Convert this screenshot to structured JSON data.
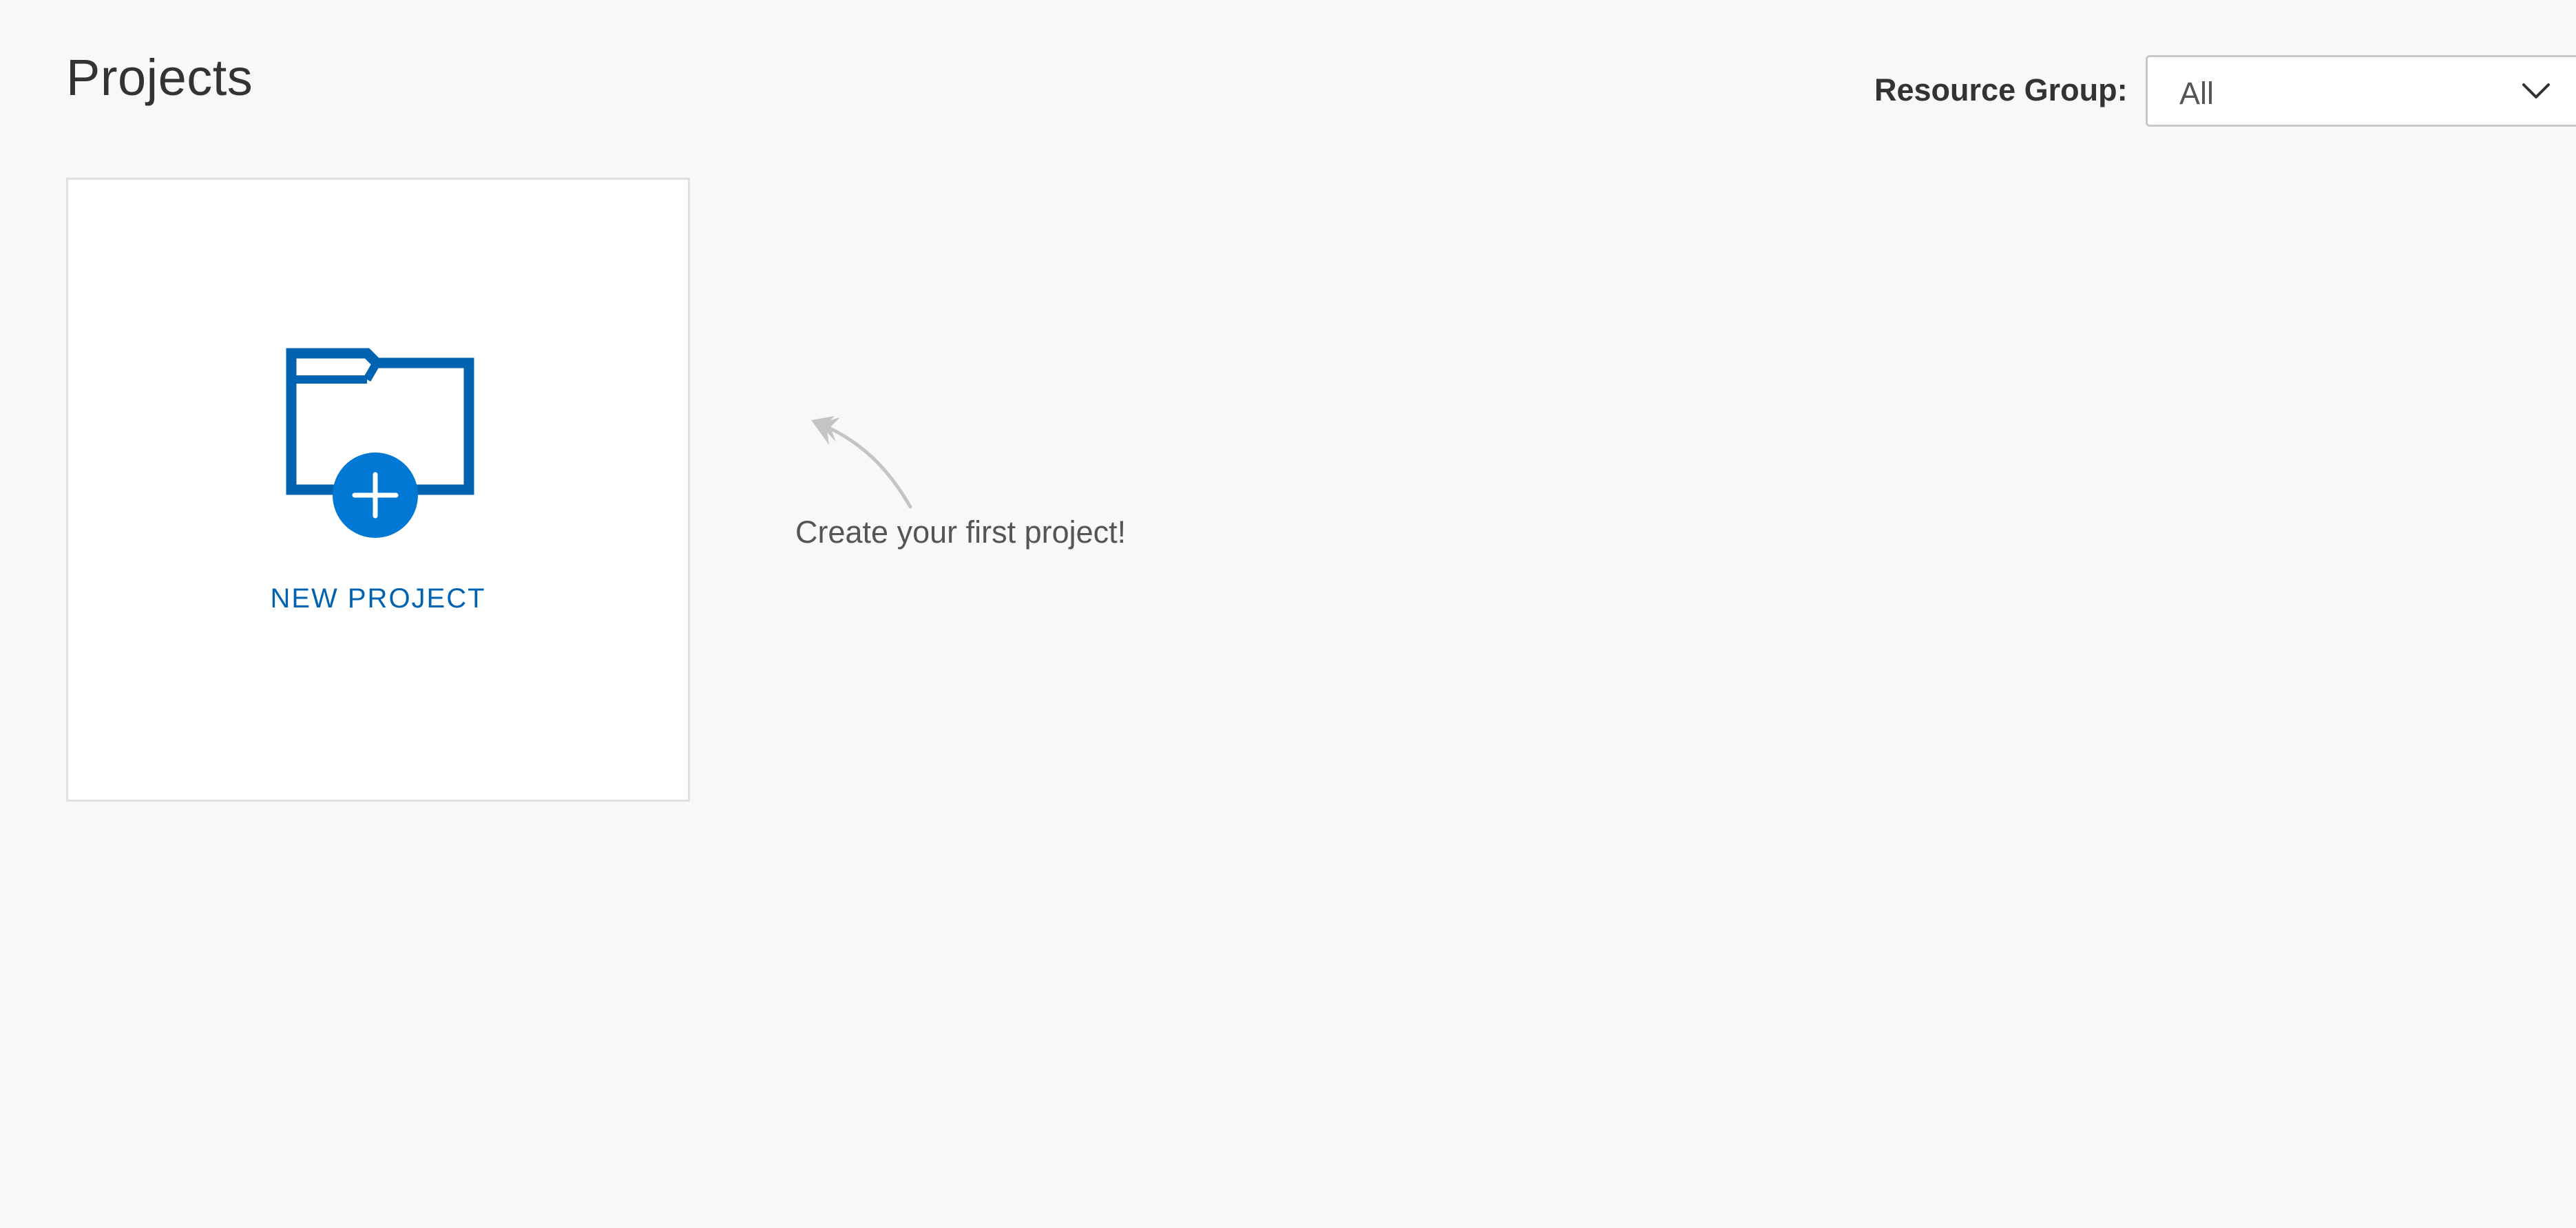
{
  "header": {
    "title": "Projects"
  },
  "filter": {
    "label": "Resource Group:",
    "selected": "All",
    "icon": "chevron-down-icon"
  },
  "new_project_card": {
    "label": "NEW PROJECT",
    "icon": "folder-add-icon",
    "accent_color": "#0063b1",
    "plus_color": "#0078d4"
  },
  "hint": {
    "text": "Create your first project!",
    "icon": "curved-arrow-icon"
  }
}
